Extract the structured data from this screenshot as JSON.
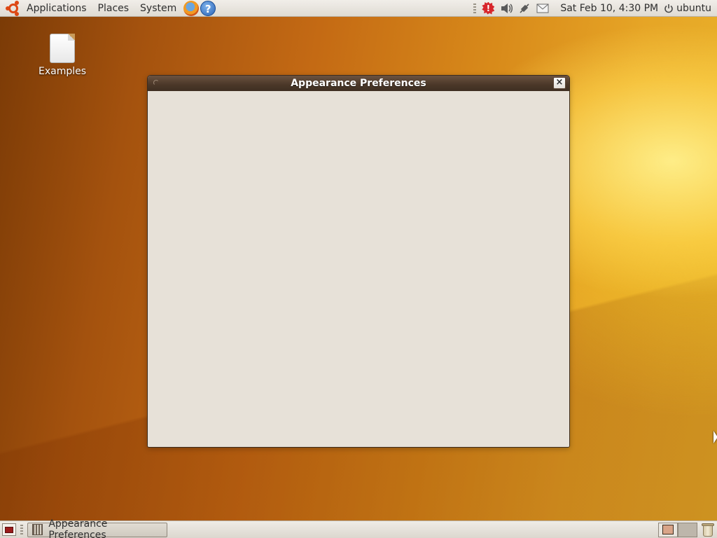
{
  "top_panel": {
    "menus": [
      "Applications",
      "Places",
      "System"
    ],
    "launchers": [
      "firefox-icon",
      "help-icon"
    ],
    "updates_badge": "!",
    "tray_icons": [
      "update-notifier-icon",
      "volume-icon",
      "network-icon",
      "mail-icon"
    ],
    "clock": "Sat Feb 10,  4:30 PM",
    "user": "ubuntu"
  },
  "desktop": {
    "icons": [
      {
        "label": "Examples",
        "icon": "file-icon"
      }
    ]
  },
  "window": {
    "title": "Appearance Preferences",
    "close_label": "×"
  },
  "bottom_panel": {
    "tasks": [
      {
        "label": "Appearance Preferences",
        "icon": "appearance-preferences-icon"
      }
    ],
    "workspaces": 2,
    "active_workspace": 1
  },
  "colors": {
    "ubuntu_orange": "#dd4814",
    "titlebar": "#4a3728",
    "window_bg": "#e7e1d8"
  }
}
